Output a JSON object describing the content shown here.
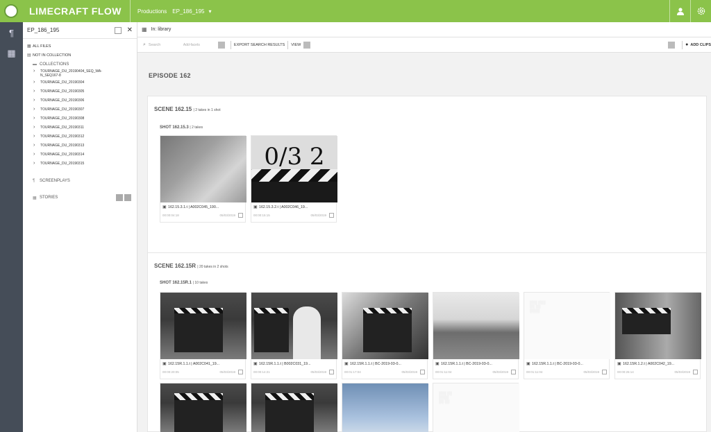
{
  "header": {
    "brand": "LIMECRAFT FLOW",
    "productions_label": "Productions",
    "production_value": "EP_186_195",
    "dropdown_glyph": "▾",
    "user_icon": "user-icon",
    "settings_icon": "gear-icon",
    "accent_color": "#8bc34a"
  },
  "rail": {
    "items": [
      {
        "icon": "paragraph-icon",
        "glyph": "¶"
      },
      {
        "icon": "table-icon",
        "glyph": "▦"
      }
    ]
  },
  "sidebar": {
    "title": "EP_186_195",
    "close_glyph": "✕",
    "all_files": "ALL FILES",
    "not_in_collection": "NOT IN COLLECTION",
    "collections_label": "COLLECTIONS",
    "collections": [
      "TOURNAGE_DU_20190404_SEQ_WA-N_SEQ167-8",
      "TOURNAGE_DU_20190304",
      "TOURNAGE_DU_20190305",
      "TOURNAGE_DU_20190306",
      "TOURNAGE_DU_20190307",
      "TOURNAGE_DU_20190308",
      "TOURNAGE_DU_20190311",
      "TOURNAGE_DU_20190312",
      "TOURNAGE_DU_20190313",
      "TOURNAGE_DU_20190314",
      "TOURNAGE_DU_20190315"
    ],
    "screenplays_label": "SCREENPLAYS",
    "stories_label": "STORIES"
  },
  "main": {
    "breadcrumb": "In: library",
    "toolbar": {
      "search_placeholder": "Search",
      "filter_placeholder": "Add-facets",
      "export_label": "EXPORT SEARCH RESULTS",
      "view_label": "VIEW",
      "add_clips_label": "ADD CLIPS"
    },
    "episode_title": "EPISODE 162",
    "scenes": [
      {
        "title": "SCENE 162.15",
        "subtitle": "| 2 takes in 1 shot",
        "shots": [
          {
            "title": "SHOT 162.15.3",
            "subtitle": "| 2 takes",
            "clips": [
              {
                "name": "162.15.3.1.t | A002C045_190...",
                "duration": "00:00:04:18",
                "date": "05/03/2019"
              },
              {
                "name": "162.15.3.2.t | A002C046_19...",
                "duration": "00:00:15:15",
                "date": "05/03/2019"
              }
            ]
          }
        ]
      },
      {
        "title": "SCENE 162.15R",
        "subtitle": "| 20 takes in 2 shots",
        "shots": [
          {
            "title": "SHOT 162.15R.1",
            "subtitle": "| 10 takes",
            "clips": [
              {
                "name": "162.15R.1.1.t | A002C041_19...",
                "duration": "00:00:20:05",
                "date": "05/03/2019"
              },
              {
                "name": "162.15R.1.1.t | B002C031_19...",
                "duration": "00:00:14:21",
                "date": "05/03/2019"
              },
              {
                "name": "162.15R.1.1.t | BC-2019-03-0...",
                "duration": "00:01:17:04",
                "date": "05/03/2019"
              },
              {
                "name": "162.15R.1.1.t | BC-2019-03-0...",
                "duration": "00:01:11:04",
                "date": "05/03/2019"
              },
              {
                "name": "162.15R.1.1.t | BC-2019-03-0...",
                "duration": "00:01:11:04",
                "date": "05/03/2019"
              },
              {
                "name": "162.15R.1.2.t | A002C042_19...",
                "duration": "00:00:26:14",
                "date": "05/03/2019"
              }
            ]
          }
        ]
      }
    ],
    "slate_text": "0/3 2"
  }
}
